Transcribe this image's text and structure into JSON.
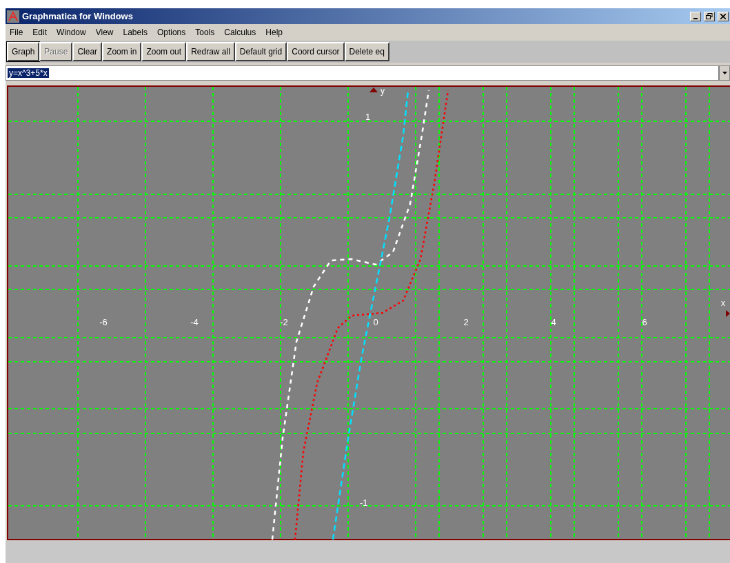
{
  "window": {
    "title": "Graphmatica for Windows"
  },
  "menu": [
    "File",
    "Edit",
    "Window",
    "View",
    "Labels",
    "Options",
    "Tools",
    "Calculus",
    "Help"
  ],
  "toolbar": [
    {
      "label": "Graph",
      "disabled": false,
      "default": true
    },
    {
      "label": "Pause",
      "disabled": true,
      "default": false
    },
    {
      "label": "Clear",
      "disabled": false,
      "default": false
    },
    {
      "label": "Zoom in",
      "disabled": false,
      "default": false
    },
    {
      "label": "Zoom out",
      "disabled": false,
      "default": false
    },
    {
      "label": "Redraw all",
      "disabled": false,
      "default": false
    },
    {
      "label": "Default grid",
      "disabled": false,
      "default": false
    },
    {
      "label": "Coord cursor",
      "disabled": false,
      "default": false
    },
    {
      "label": "Delete eq",
      "disabled": false,
      "default": false
    }
  ],
  "equation": {
    "value": "y=x^3+5*x",
    "text_selected": true
  },
  "graph": {
    "x_axis_label": "x",
    "y_axis_label": "y",
    "x_labels": [
      "-6",
      "-4",
      "-2",
      "0",
      "2",
      "4",
      "6"
    ],
    "y_labels": [
      "1",
      "-1"
    ],
    "curves": [
      {
        "color": "#ffffff"
      },
      {
        "color": "#00e0ff"
      },
      {
        "color": "#ff0000"
      }
    ]
  }
}
